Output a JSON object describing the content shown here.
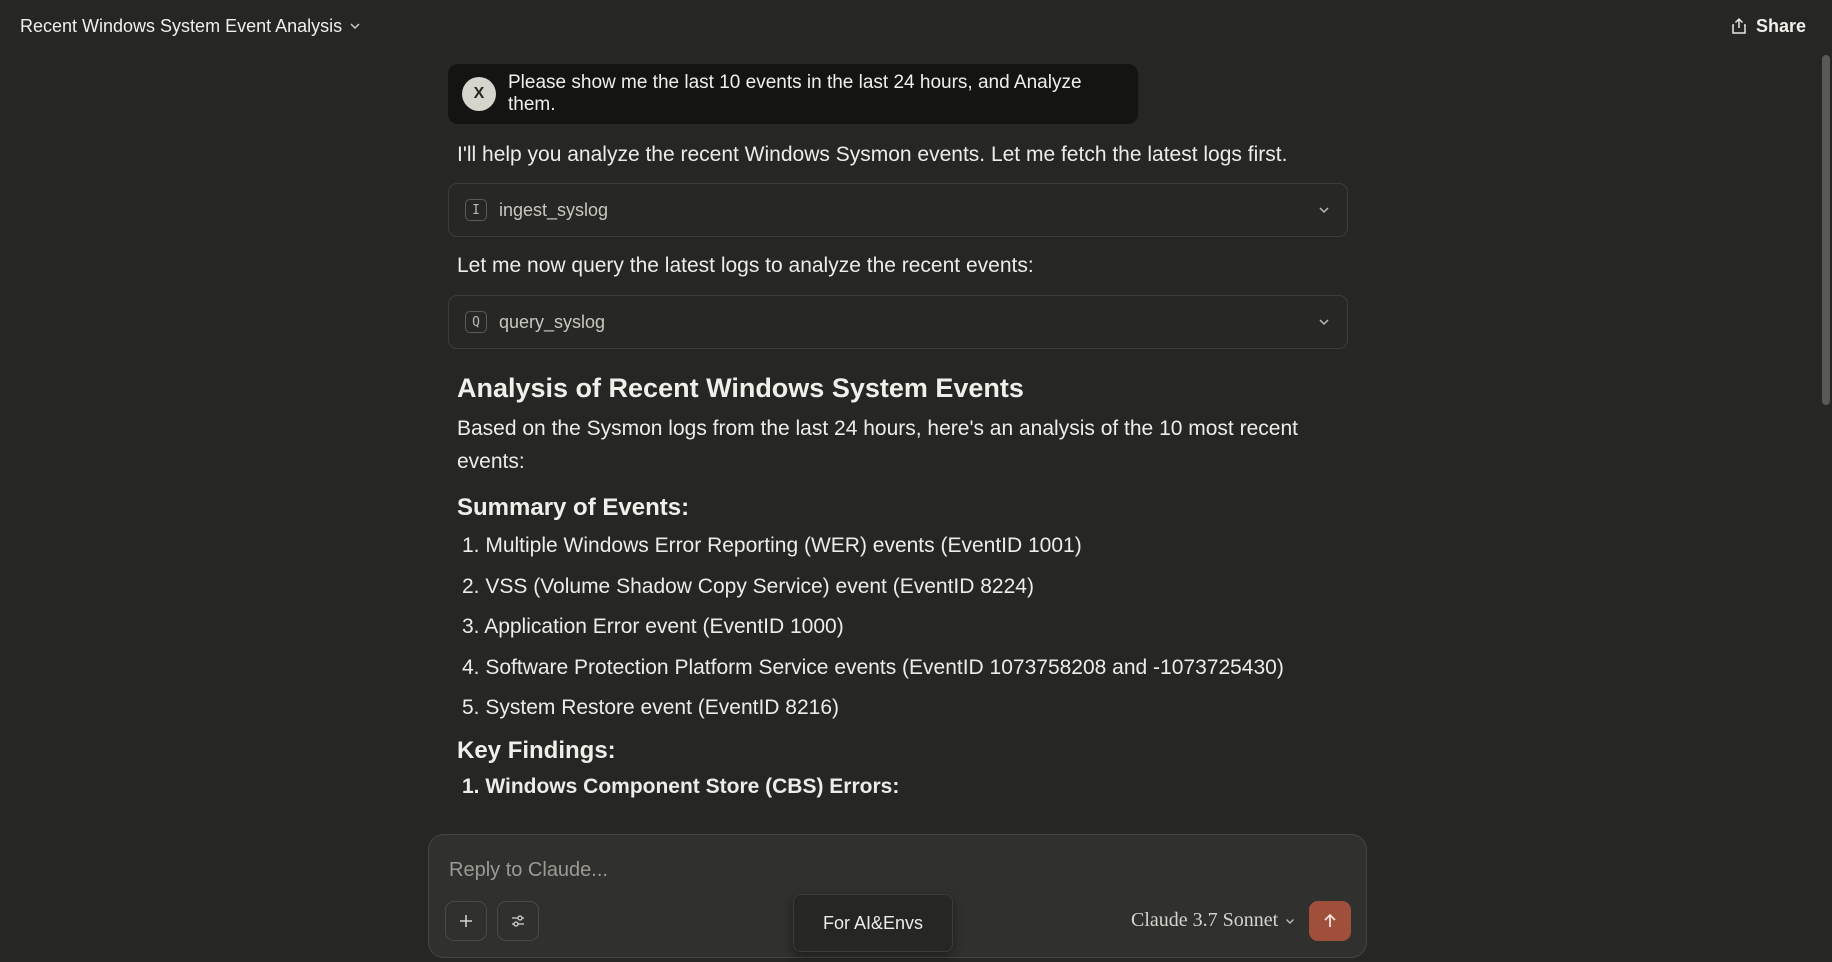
{
  "header": {
    "title": "Recent Windows System Event Analysis",
    "share_label": "Share"
  },
  "user_message": {
    "avatar_initial": "X",
    "text": "Please show me the last 10 events in the last 24 hours, and Analyze them."
  },
  "assistant": {
    "intro": "I'll help you analyze the recent Windows Sysmon events. Let me fetch the latest logs first.",
    "tool1": {
      "icon_letter": "I",
      "name": "ingest_syslog"
    },
    "mid": "Let me now query the latest logs to analyze the recent events:",
    "tool2": {
      "icon_letter": "Q",
      "name": "query_syslog"
    },
    "heading": "Analysis of Recent Windows System Events",
    "lead": "Based on the Sysmon logs from the last 24 hours, here's an analysis of the 10 most recent events:",
    "summary_heading": "Summary of Events:",
    "summary_items": [
      "1. Multiple Windows Error Reporting (WER) events (EventID 1001)",
      "2. VSS (Volume Shadow Copy Service) event (EventID 8224)",
      "3. Application Error event (EventID 1000)",
      "4. Software Protection Platform Service events (EventID 1073758208 and -1073725430)",
      "5. System Restore event (EventID 8216)"
    ],
    "findings_heading": "Key Findings:",
    "findings_first": "1. Windows Component Store (CBS) Errors:"
  },
  "composer": {
    "placeholder": "Reply to Claude...",
    "model_label": "Claude 3.7 Sonnet",
    "tooltip": "For AI&Envs"
  },
  "icons": {
    "add": "plus-icon",
    "tools": "sliders-icon",
    "send": "arrow-up-icon",
    "share": "share-icon"
  },
  "colors": {
    "background": "#262624",
    "user_bubble": "#141413",
    "send_button": "#a04f3a"
  }
}
